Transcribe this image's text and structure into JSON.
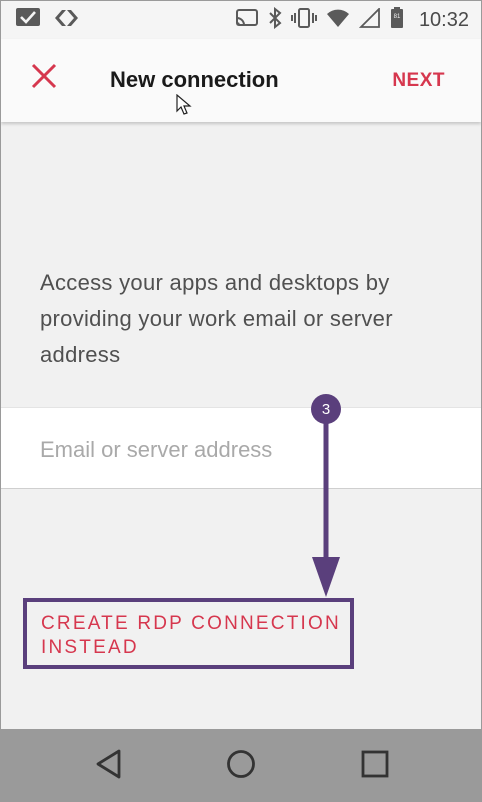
{
  "status_bar": {
    "time": "10:32",
    "battery_level": "81",
    "icons": [
      "checkbox-icon",
      "code-icon",
      "cast-icon",
      "bluetooth-icon",
      "vibrate-icon",
      "wifi-icon",
      "signal-icon",
      "battery-icon"
    ]
  },
  "app_bar": {
    "title": "New connection",
    "next_label": "NEXT",
    "close_icon": "close-icon",
    "accent_color": "#d6374e"
  },
  "content": {
    "intro": "Access your apps and desktops by providing your work email or server address",
    "input_placeholder": "Email or server address",
    "input_value": "",
    "rdp_link": "CREATE RDP CONNECTION INSTEAD"
  },
  "annotation": {
    "step_number": "3",
    "color": "#5a3f7c"
  },
  "nav_bar": {
    "buttons": [
      "back-icon",
      "home-icon",
      "recents-icon"
    ]
  }
}
